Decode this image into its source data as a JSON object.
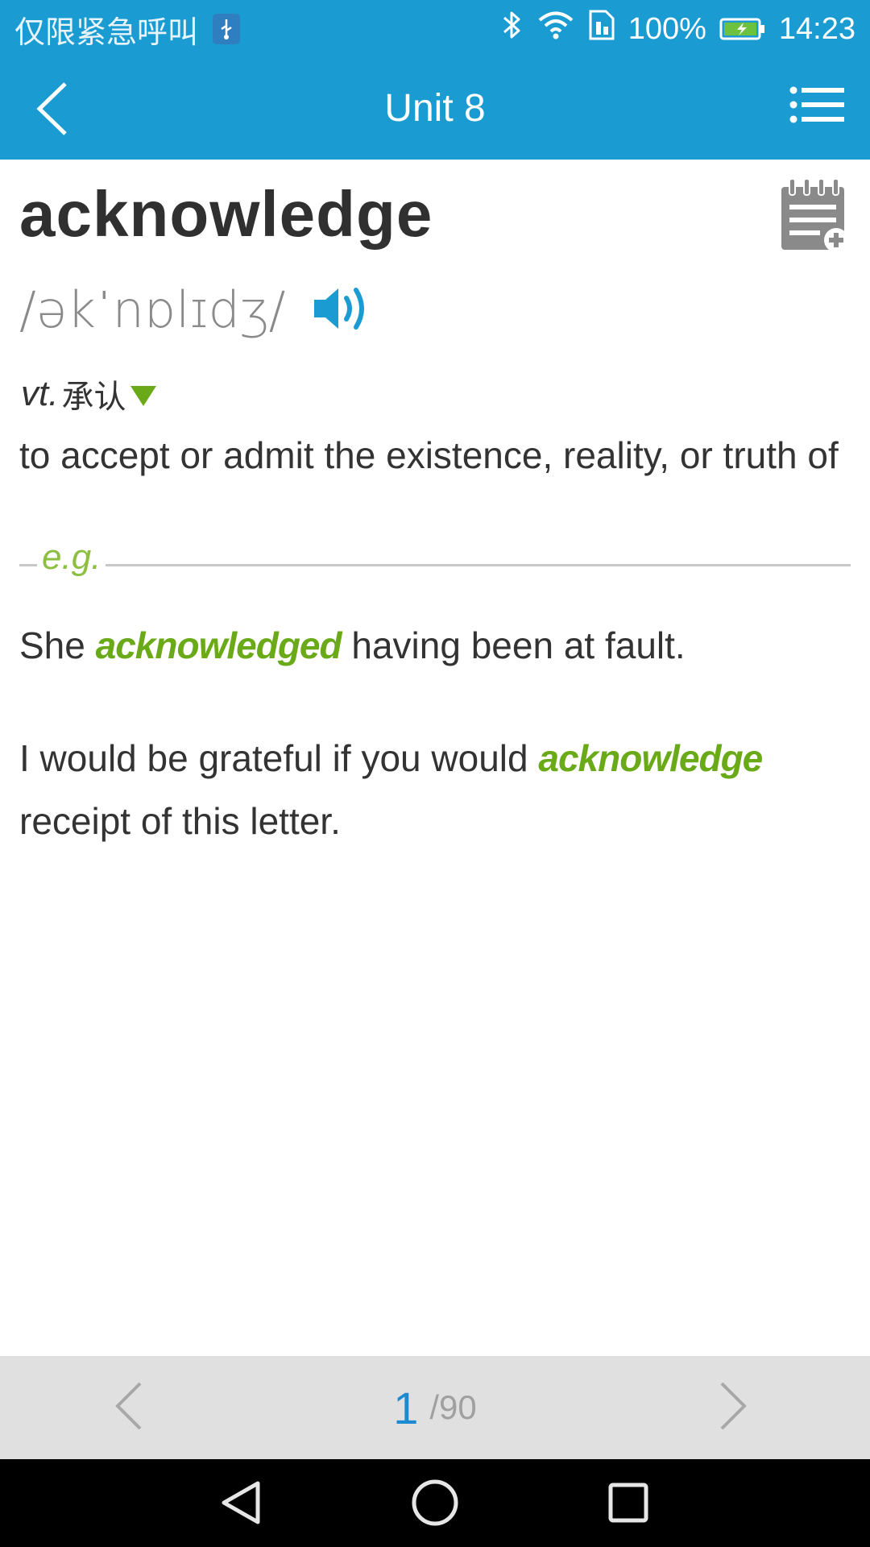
{
  "status_bar": {
    "carrier": "仅限紧急呼叫",
    "battery": "100%",
    "time": "14:23",
    "icons": [
      "usb-icon",
      "bluetooth-icon",
      "wifi-icon",
      "sim-icon",
      "battery-charging-icon"
    ]
  },
  "app_bar": {
    "title": "Unit 8",
    "back_icon": "chevron-left-icon",
    "menu_icon": "list-icon"
  },
  "entry": {
    "word": "acknowledge",
    "phonetic": "/əkˈnɒlɪdʒ/",
    "part_of_speech": "vt.",
    "meaning_cn": "承认",
    "definition": "to accept or admit the existence, reality, or truth of",
    "eg_label": "e.g.",
    "examples": [
      {
        "before": "She ",
        "highlight": "acknowledged",
        "after": " having been at fault."
      },
      {
        "before": "I would be grateful if you would ",
        "highlight": "acknowledge",
        "after": " receipt of this letter."
      }
    ]
  },
  "pager": {
    "current": "1",
    "total": "/90"
  },
  "colors": {
    "primary": "#1a9bd2",
    "highlight_green": "#6aaa18",
    "eg_green": "#8cbf3f",
    "pager_bg": "#e0e0e0"
  }
}
